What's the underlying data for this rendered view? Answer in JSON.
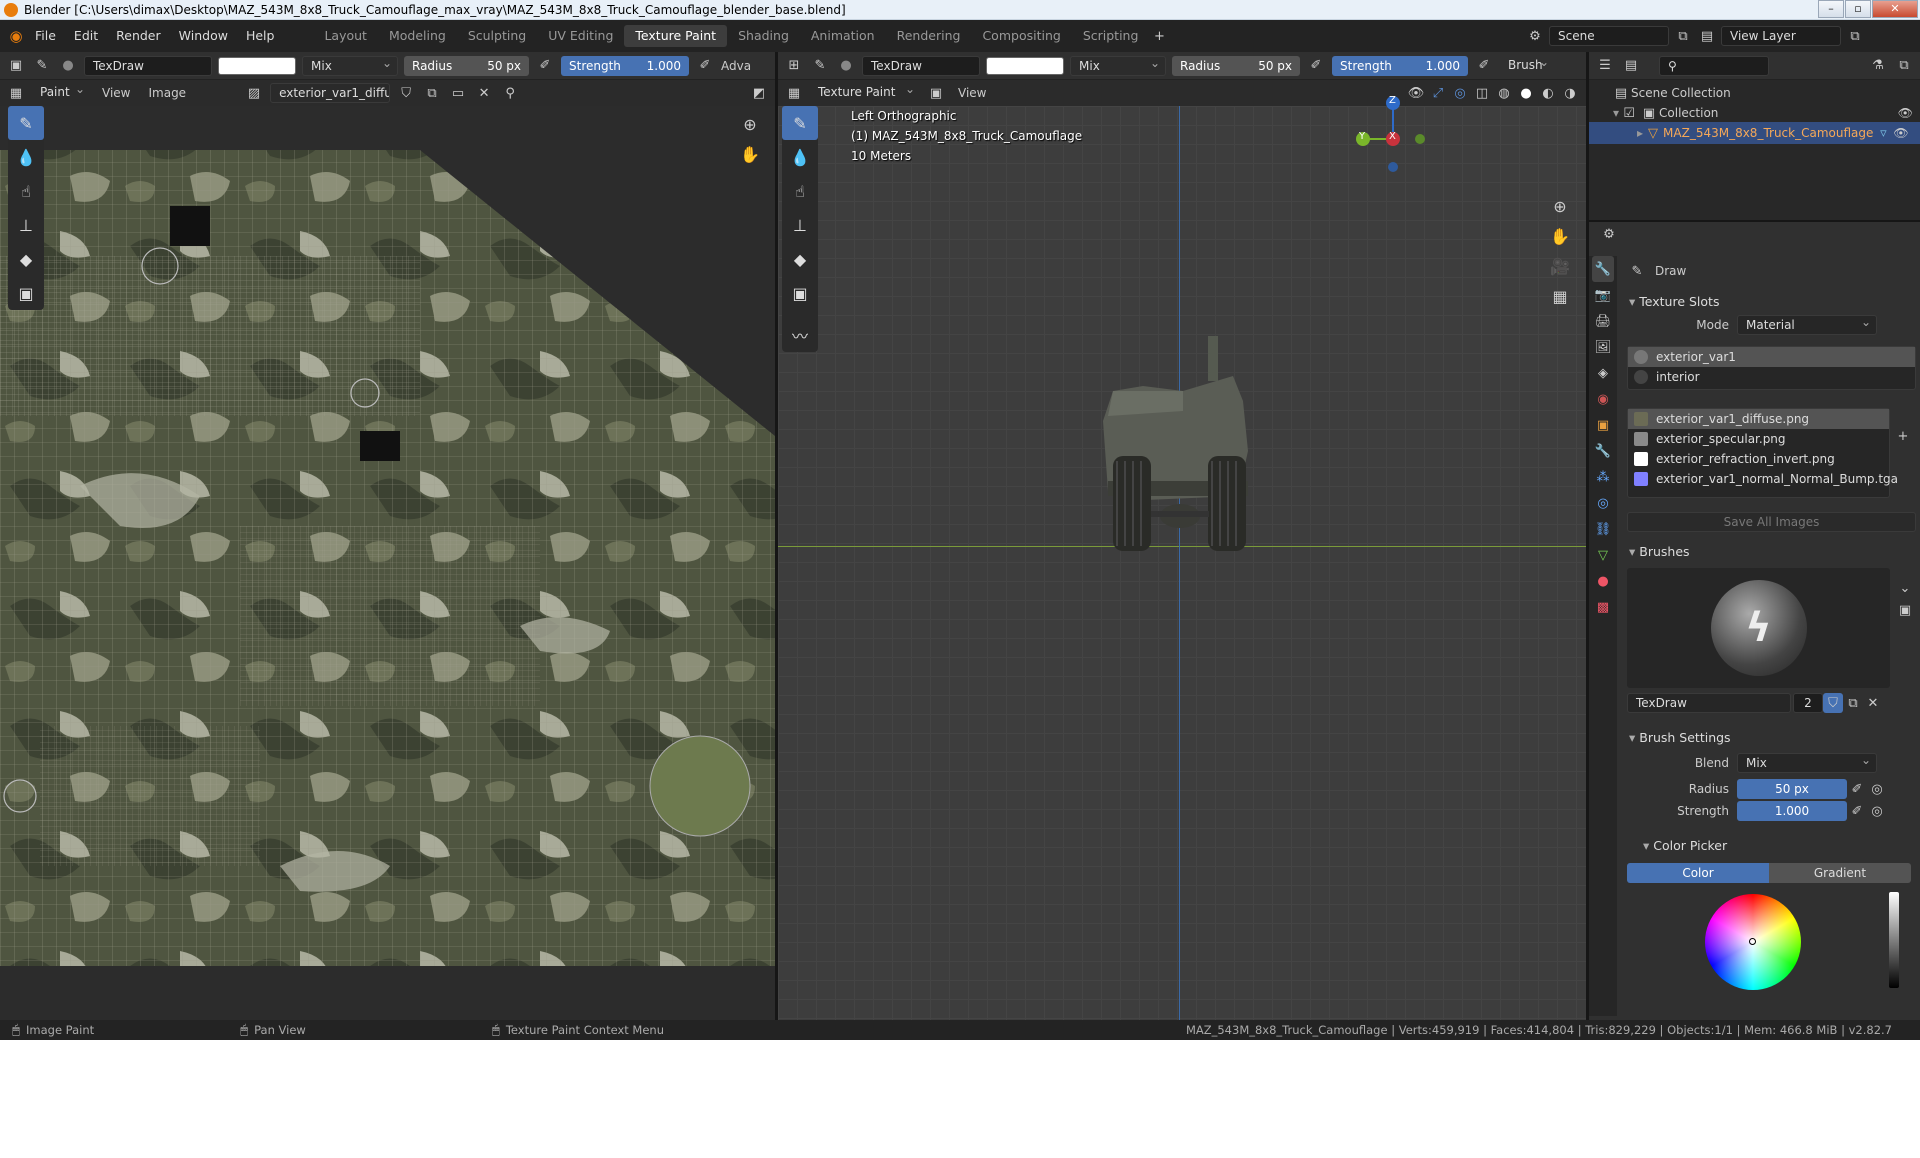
{
  "window": {
    "title": "Blender [C:\\Users\\dimax\\Desktop\\MAZ_543M_8x8_Truck_Camouflage_max_vray\\MAZ_543M_8x8_Truck_Camouflage_blender_base.blend]"
  },
  "menu": [
    "File",
    "Edit",
    "Render",
    "Window",
    "Help"
  ],
  "workspaces": [
    "Layout",
    "Modeling",
    "Sculpting",
    "UV Editing",
    "Texture Paint",
    "Shading",
    "Animation",
    "Rendering",
    "Compositing",
    "Scripting"
  ],
  "active_workspace": "Texture Paint",
  "scene": {
    "label": "Scene",
    "view_layer": "View Layer"
  },
  "image_editor": {
    "brush_name": "TexDraw",
    "blend": "Mix",
    "radius_label": "Radius",
    "radius_value": "50 px",
    "strength_label": "Strength",
    "strength_value": "1.000",
    "adv_label": "Adva",
    "mode": "Paint",
    "menus": [
      "View",
      "Image"
    ],
    "image_name": "exterior_var1_diffus..."
  },
  "viewport": {
    "brush_name": "TexDraw",
    "blend": "Mix",
    "radius_label": "Radius",
    "radius_value": "50 px",
    "strength_label": "Strength",
    "strength_value": "1.000",
    "brush_menu": "Brush",
    "mode": "Texture Paint",
    "view_menu": "View",
    "overlay_line1": "Left Orthographic",
    "overlay_line2": "(1) MAZ_543M_8x8_Truck_Camouflage",
    "overlay_line3": "10 Meters",
    "gizmo_z": "Z",
    "gizmo_y": "Y",
    "gizmo_x": "X"
  },
  "outliner": {
    "scene_collection": "Scene Collection",
    "collection": "Collection",
    "object": "MAZ_543M_8x8_Truck_Camouflage"
  },
  "properties": {
    "tool_name": "Draw",
    "texture_slots_title": "Texture Slots",
    "mode_label": "Mode",
    "mode_value": "Material",
    "materials": [
      "exterior_var1",
      "interior"
    ],
    "images": [
      {
        "name": "exterior_var1_diffuse.png",
        "color": "#6b6b55"
      },
      {
        "name": "exterior_specular.png",
        "color": "#8a8a8a"
      },
      {
        "name": "exterior_refraction_invert.png",
        "color": "#ffffff"
      },
      {
        "name": "exterior_var1_normal_Normal_Bump.tga",
        "color": "#8080ff"
      }
    ],
    "save_all": "Save All Images",
    "brushes_title": "Brushes",
    "brush_name": "TexDraw",
    "brush_users": "2",
    "brush_settings_title": "Brush Settings",
    "blend_label": "Blend",
    "blend_value": "Mix",
    "radius_label": "Radius",
    "radius_value": "50 px",
    "strength_label": "Strength",
    "strength_value": "1.000",
    "color_picker_title": "Color Picker",
    "color_tab": "Color",
    "gradient_tab": "Gradient"
  },
  "statusbar": {
    "item1": "Image Paint",
    "item2": "Pan View",
    "item3": "Texture Paint Context Menu",
    "stats": "MAZ_543M_8x8_Truck_Camouflage | Verts:459,919 | Faces:414,804 | Tris:829,229 | Objects:1/1 | Mem: 466.8 MiB | v2.82.7"
  }
}
